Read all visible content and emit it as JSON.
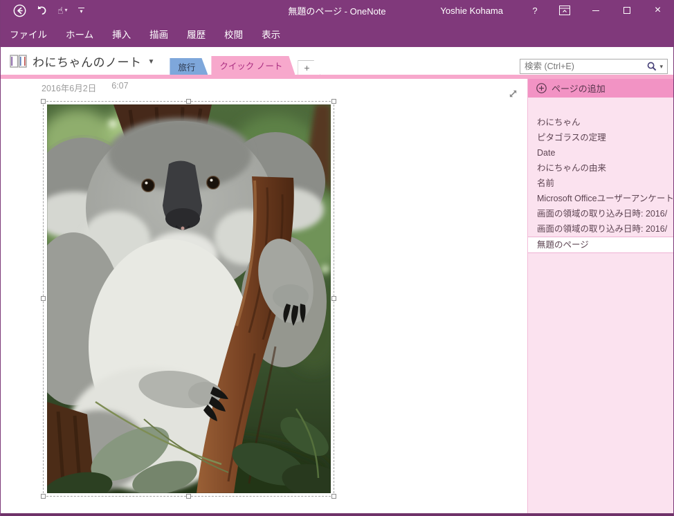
{
  "titlebar": {
    "title": "無題のページ - OneNote",
    "user": "Yoshie Kohama"
  },
  "icons": {
    "help": "?",
    "close": "×",
    "touch_mode": "☝",
    "caret_down": "▾",
    "notebook_caret": "▼"
  },
  "menubar": {
    "items": [
      "ファイル",
      "ホーム",
      "挿入",
      "描画",
      "履歴",
      "校閲",
      "表示"
    ]
  },
  "notebook": {
    "name": "わにちゃんのノート"
  },
  "section_tabs": {
    "travel": "旅行",
    "quick_notes": "クイック ノート",
    "add": "+"
  },
  "search": {
    "placeholder": "検索 (Ctrl+E)"
  },
  "page": {
    "date": "2016年6月2日",
    "time": "6:07"
  },
  "sidebar": {
    "add_page_label": "ページの追加",
    "pages": [
      "わにちゃん",
      "ピタゴラスの定理",
      "Date",
      "わにちゃんの由来",
      "名前",
      "Microsoft Officeユーザーアンケート",
      "画面の領域の取り込み日時: 2016/",
      "画面の領域の取り込み日時: 2016/",
      "無題のページ"
    ],
    "selected_page": "無題のページ"
  },
  "image": {
    "description": "koala on tree branch"
  },
  "colors": {
    "accent_purple": "#80397B",
    "tab_pink": "#F7A8CC",
    "sidebar_pink": "#FBE2EF",
    "sidebar_header_pink": "#F293C4",
    "tab_blue": "#7EA7DB"
  }
}
